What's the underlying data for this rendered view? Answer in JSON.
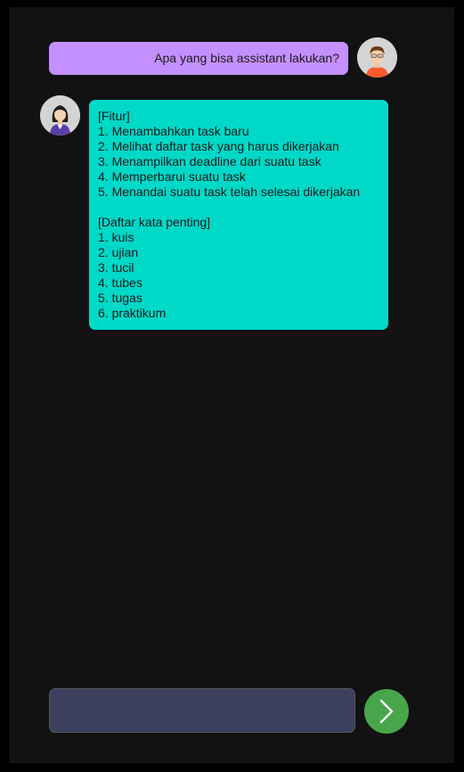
{
  "chat": {
    "messages": [
      {
        "sender": "user",
        "avatar_icon": "male-user-avatar-icon",
        "text": "Apa yang bisa assistant lakukan?"
      },
      {
        "sender": "assistant",
        "avatar_icon": "female-assistant-avatar-icon",
        "lines": [
          "[Fitur]",
          "1. Menambahkan task baru",
          "2. Melihat daftar task yang harus dikerjakan",
          "3. Menampilkan deadline dari suatu task",
          "4. Memperbarui suatu task",
          "5. Menandai suatu task telah selesai dikerjakan",
          "",
          "[Daftar kata penting]",
          "1. kuis",
          "2. ujian",
          "3. tucil",
          "4. tubes",
          "5. tugas",
          "6. praktikum"
        ]
      }
    ]
  },
  "composer": {
    "input_value": "",
    "send_icon": "chevron-right-icon"
  },
  "colors": {
    "page_background": "#000000",
    "app_background": "#121212",
    "user_bubble": "#c490ff",
    "assistant_bubble": "#00d8c8",
    "input_background": "#3c3f5e",
    "send_button": "#47a64a"
  }
}
